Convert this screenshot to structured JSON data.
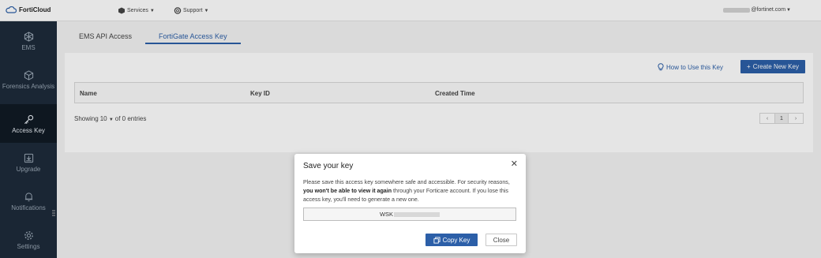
{
  "header": {
    "logo": "FortiCloud",
    "services": "Services",
    "support": "Support",
    "user_suffix": "@fortinet.com"
  },
  "sidebar": {
    "items": [
      {
        "label": "EMS",
        "icon": "cube-icon"
      },
      {
        "label": "Forensics Analysis",
        "icon": "box-icon"
      },
      {
        "label": "Access Key",
        "icon": "key-icon"
      },
      {
        "label": "Upgrade",
        "icon": "upgrade-icon"
      },
      {
        "label": "Notifications",
        "icon": "bell-icon"
      },
      {
        "label": "Settings",
        "icon": "gear-icon"
      }
    ]
  },
  "tabs": [
    "EMS API Access",
    "FortiGate Access Key"
  ],
  "toolbar": {
    "how_to": "How to Use this Key",
    "create": "Create New Key"
  },
  "table": {
    "columns": [
      "Name",
      "Key ID",
      "Created Time"
    ]
  },
  "footer": {
    "showing": "Showing",
    "page_size": "10",
    "entries": "of 0 entries",
    "page": "1"
  },
  "modal": {
    "title": "Save your key",
    "body_1": "Please save this access key somewhere safe and accessible. For security reasons,",
    "body_bold": "you won't be able to view it again",
    "body_2": " through your Forticare account. If you lose this access key, you'll need to generate a new one.",
    "key_prefix": "WSK",
    "copy_label": "Copy Key",
    "close_label": "Close"
  },
  "colors": {
    "accent": "#2c5fa8",
    "sidebar": "#1d2b3a",
    "sidebar_active": "#101a24"
  }
}
